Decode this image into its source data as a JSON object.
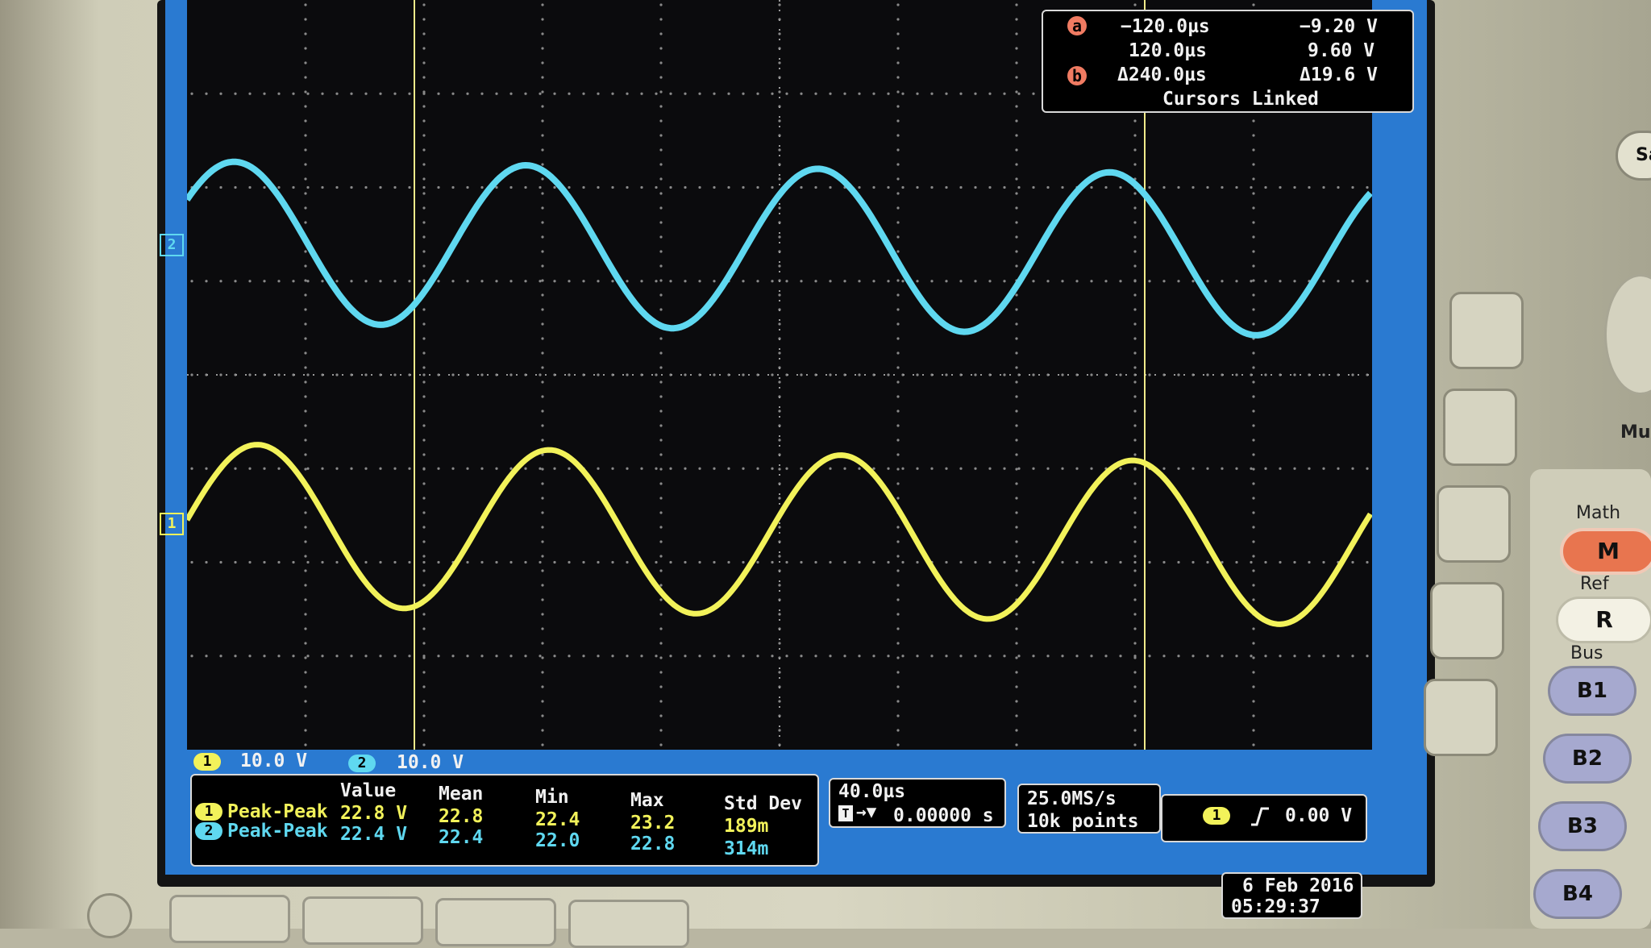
{
  "cursor_readout": {
    "a_badge": "a",
    "b_badge": "b",
    "a_time": "−120.0µs",
    "a_volt": "−9.20 V",
    "b_time": "120.0µs",
    "b_volt": "9.60 V",
    "delta_time": "Δ240.0µs",
    "delta_volt": "Δ19.6 V",
    "link_status": "Cursors Linked"
  },
  "channel_markers": {
    "ch1": "1",
    "ch2": "2"
  },
  "channel_scales": {
    "ch1_badge": "1",
    "ch1_scale": "10.0 V",
    "ch2_badge": "2",
    "ch2_scale": "10.0 V"
  },
  "measurements": {
    "headers": {
      "value": "Value",
      "mean": "Mean",
      "min": "Min",
      "max": "Max",
      "std": "Std Dev"
    },
    "rows": [
      {
        "badge": "1",
        "name": "Peak-Peak",
        "value": "22.8 V",
        "mean": "22.8",
        "min": "22.4",
        "max": "23.2",
        "std": "189m"
      },
      {
        "badge": "2",
        "name": "Peak-Peak",
        "value": "22.4 V",
        "mean": "22.4",
        "min": "22.0",
        "max": "22.8",
        "std": "314m"
      }
    ]
  },
  "horizontal": {
    "scale": "40.0µs",
    "trigger_position": "0.00000 s",
    "trigger_icon": "T"
  },
  "acquisition": {
    "rate": "25.0MS/s",
    "points": "10k points"
  },
  "trigger": {
    "source": "1",
    "slope_icon": "rising-edge-icon",
    "level": "0.00 V"
  },
  "datetime": {
    "date": "6 Feb 2016",
    "time": "05:29:37"
  },
  "side_panel": {
    "math_label": "Math",
    "math_button": "M",
    "ref_label": "Ref",
    "ref_button": "R",
    "bus_label": "Bus",
    "bus_buttons": [
      "B1",
      "B2",
      "B3",
      "B4"
    ],
    "top_button_partial": "Sa",
    "knob_label_partial": "Mul"
  },
  "colors": {
    "ch1": "#f2f25a",
    "ch2": "#5fd8f0",
    "screen_border": "#2a7ad1",
    "math_button": "#e8754f"
  }
}
